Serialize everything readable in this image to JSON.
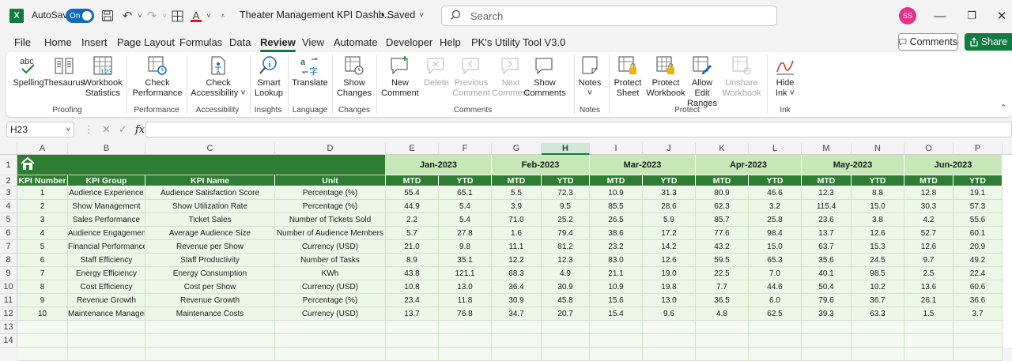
{
  "app": {
    "autosave_label": "AutoSave",
    "autosave_state": "On",
    "document_title": "Theater Management KPI Dashb...",
    "save_status": "• Saved",
    "search_placeholder": "Search",
    "user_initials": "SS"
  },
  "menu": {
    "items": [
      "File",
      "Home",
      "Insert",
      "Page Layout",
      "Formulas",
      "Data",
      "Review",
      "View",
      "Automate",
      "Developer",
      "Help",
      "PK's Utility Tool V3.0"
    ],
    "active": "Review",
    "comments_label": "Comments",
    "share_label": "Share"
  },
  "ribbon": {
    "buttons": {
      "spelling": "Spelling",
      "thesaurus": "Thesaurus",
      "workbook_statistics_1": "Workbook",
      "workbook_statistics_2": "Statistics",
      "check_performance_1": "Check",
      "check_performance_2": "Performance",
      "check_accessibility_1": "Check",
      "check_accessibility_2": "Accessibility ˅",
      "smart_lookup_1": "Smart",
      "smart_lookup_2": "Lookup",
      "translate": "Translate",
      "show_changes_1": "Show",
      "show_changes_2": "Changes",
      "new_comment_1": "New",
      "new_comment_2": "Comment",
      "delete": "Delete",
      "previous_comment_1": "Previous",
      "previous_comment_2": "Comment",
      "next_comment_1": "Next",
      "next_comment_2": "Comment",
      "show_comments_1": "Show",
      "show_comments_2": "Comments",
      "notes_1": "Notes",
      "notes_2": "˅",
      "protect_sheet_1": "Protect",
      "protect_sheet_2": "Sheet",
      "protect_workbook_1": "Protect",
      "protect_workbook_2": "Workbook",
      "allow_edit_ranges_1": "Allow Edit",
      "allow_edit_ranges_2": "Ranges",
      "unshare_workbook_1": "Unshare",
      "unshare_workbook_2": "Workbook",
      "hide_ink_1": "Hide",
      "hide_ink_2": "Ink ˅"
    },
    "groups": [
      "Proofing",
      "Performance",
      "Accessibility",
      "Insights",
      "Language",
      "Changes",
      "Comments",
      "Notes",
      "Protect",
      "Ink"
    ]
  },
  "formula_bar": {
    "name_box": "H23",
    "fx_label": "fx",
    "formula": ""
  },
  "sheet": {
    "column_letters": [
      "A",
      "B",
      "C",
      "D",
      "E",
      "F",
      "G",
      "H",
      "I",
      "J",
      "K",
      "L",
      "M",
      "N",
      "O",
      "P"
    ],
    "selected_column": "H",
    "row_numbers": [
      "1",
      "2",
      "3",
      "4",
      "5",
      "6",
      "7",
      "8",
      "9",
      "10",
      "11",
      "12",
      "13",
      "14"
    ],
    "months": [
      "Jan-2023",
      "Feb-2023",
      "Mar-2023",
      "Apr-2023",
      "May-2023",
      "Jun-2023"
    ],
    "headers": [
      "KPI Number",
      "KPI Group",
      "KPI Name",
      "Unit"
    ],
    "sub_headers": [
      "MTD",
      "YTD"
    ],
    "rows": [
      [
        "1",
        "Audience Experience",
        "Audience Satisfaction Score",
        "Percentage (%)",
        "55.4",
        "65.1",
        "5.5",
        "72.3",
        "10.9",
        "31.3",
        "80.9",
        "46.6",
        "12.3",
        "8.8",
        "12.8",
        "19.1"
      ],
      [
        "2",
        "Show Management",
        "Show Utilization Rate",
        "Percentage (%)",
        "44.9",
        "5.4",
        "3.9",
        "9.5",
        "85.5",
        "28.6",
        "62.3",
        "3.2",
        "115.4",
        "15.0",
        "30.3",
        "57.3"
      ],
      [
        "3",
        "Sales Performance",
        "Ticket Sales",
        "Number of Tickets Sold",
        "2.2",
        "5.4",
        "71.0",
        "25.2",
        "26.5",
        "5.9",
        "85.7",
        "25.8",
        "23.6",
        "3.8",
        "4.2",
        "55.6"
      ],
      [
        "4",
        "Audience Engagement",
        "Average Audience Size",
        "Number of Audience Members",
        "5.7",
        "27.8",
        "1.6",
        "79.4",
        "38.6",
        "17.2",
        "77.6",
        "98.4",
        "13.7",
        "12.6",
        "52.7",
        "60.1"
      ],
      [
        "5",
        "Financial Performance",
        "Revenue per Show",
        "Currency (USD)",
        "21.0",
        "9.8",
        "11.1",
        "81.2",
        "23.2",
        "14.2",
        "43.2",
        "15.0",
        "63.7",
        "15.3",
        "12.6",
        "20.9"
      ],
      [
        "6",
        "Staff Efficiency",
        "Staff Productivity",
        "Number of Tasks",
        "8.9",
        "35.1",
        "12.2",
        "12.3",
        "83.0",
        "12.6",
        "59.5",
        "65.3",
        "35.6",
        "24.5",
        "9.7",
        "49.2"
      ],
      [
        "7",
        "Energy Efficiency",
        "Energy Consumption",
        "KWh",
        "43.8",
        "121.1",
        "68.3",
        "4.9",
        "21.1",
        "19.0",
        "22.5",
        "7.0",
        "40.1",
        "98.5",
        "2.5",
        "22.4"
      ],
      [
        "8",
        "Cost Efficiency",
        "Cost per Show",
        "Currency (USD)",
        "10.8",
        "13.0",
        "36.4",
        "30.9",
        "10.9",
        "19.8",
        "7.7",
        "44.6",
        "50.4",
        "10.2",
        "13.6",
        "60.6"
      ],
      [
        "9",
        "Revenue Growth",
        "Revenue Growth",
        "Percentage (%)",
        "23.4",
        "11.8",
        "30.9",
        "45.8",
        "15.6",
        "13.0",
        "36.5",
        "6.0",
        "79.6",
        "36.7",
        "26.1",
        "36.6"
      ],
      [
        "10",
        "Maintenance Management",
        "Maintenance Costs",
        "Currency (USD)",
        "13.7",
        "76.8",
        "34.7",
        "20.7",
        "15.4",
        "9.6",
        "4.8",
        "62.5",
        "39.3",
        "63.3",
        "1.5",
        "3.7"
      ]
    ]
  }
}
